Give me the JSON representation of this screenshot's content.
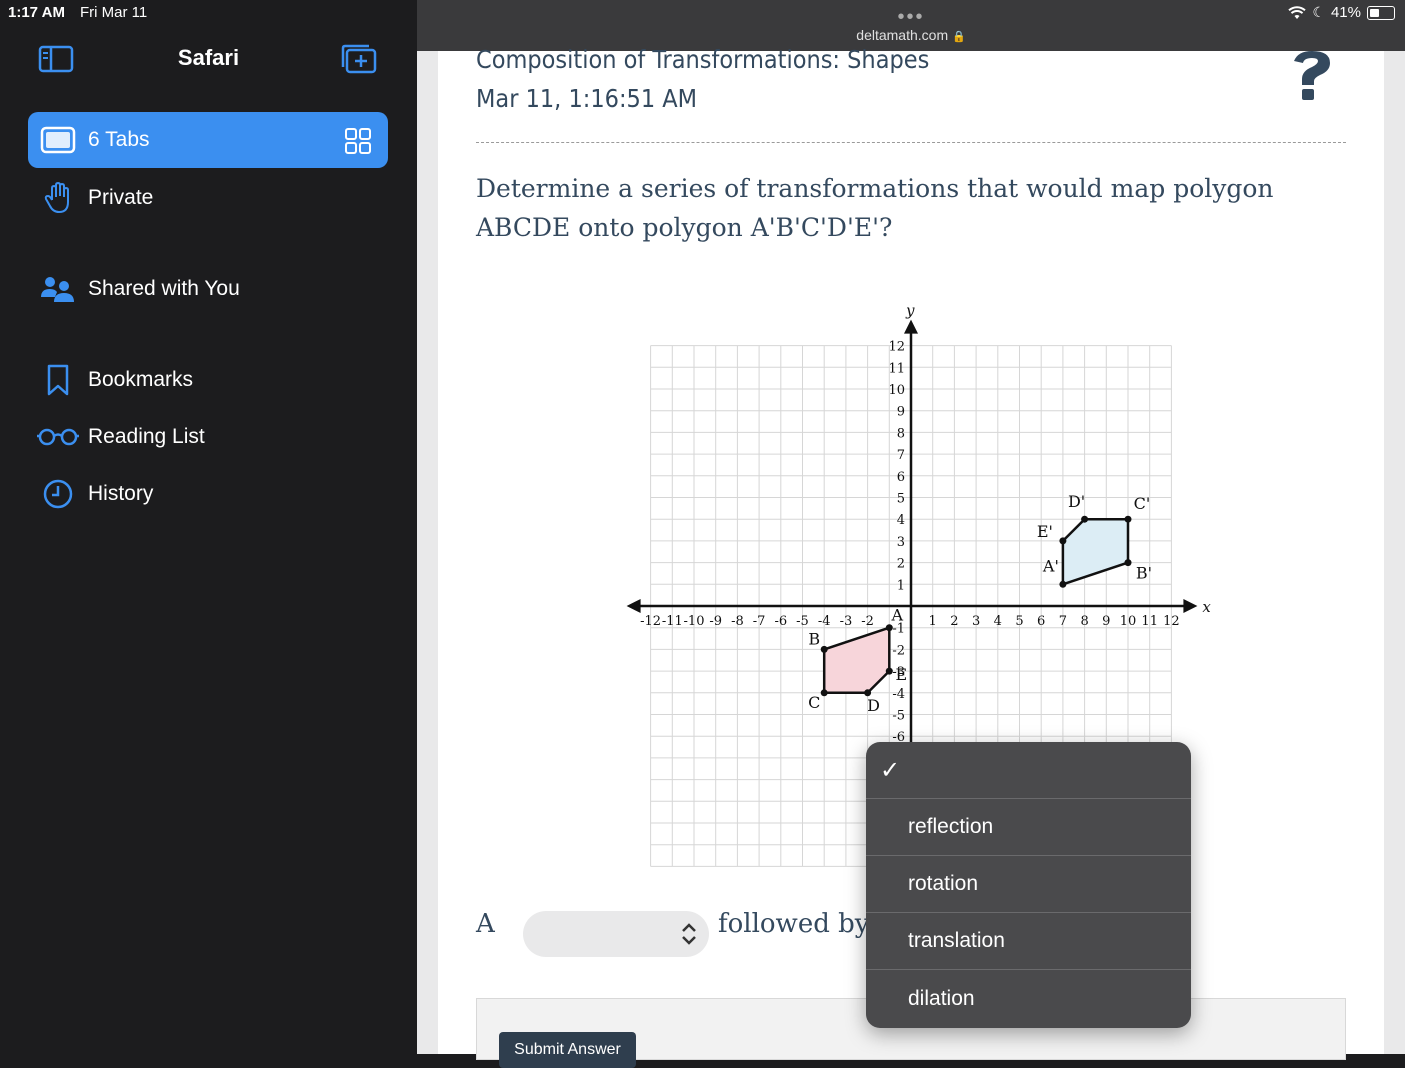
{
  "status": {
    "time": "1:17 AM",
    "date": "Fri Mar 11",
    "battery": "41%"
  },
  "sidebar": {
    "title": "Safari",
    "items": [
      {
        "label": "6 Tabs",
        "icon": "tabs-icon"
      },
      {
        "label": "Private",
        "icon": "hand-icon"
      },
      {
        "label": "Shared with You",
        "icon": "shared-icon"
      },
      {
        "label": "Bookmarks",
        "icon": "bookmark-icon"
      },
      {
        "label": "Reading List",
        "icon": "glasses-icon"
      },
      {
        "label": "History",
        "icon": "clock-icon"
      }
    ]
  },
  "browser": {
    "url": "deltamath.com",
    "dots": "•••"
  },
  "page": {
    "title": "Composition of Transformations: Shapes",
    "timestamp": "Mar 11, 1:16:51 AM",
    "question": "Determine a series of transformations that would map polygon ABCDE onto polygon A'B'C'D'E'?",
    "answer_prefix": "A",
    "answer_middle": "followed by a",
    "submit_label": "Submit Answer"
  },
  "graph": {
    "x_label": "x",
    "y_label": "y",
    "x_range": [
      -12,
      12
    ],
    "y_range": [
      -12,
      12
    ],
    "polygon_ABCDE": [
      {
        "label": "A",
        "x": -1,
        "y": -1
      },
      {
        "label": "B",
        "x": -4,
        "y": -2
      },
      {
        "label": "C",
        "x": -4,
        "y": -4
      },
      {
        "label": "D",
        "x": -2,
        "y": -4
      },
      {
        "label": "E",
        "x": -1,
        "y": -3
      }
    ],
    "polygon_prime": [
      {
        "label": "A'",
        "x": 7,
        "y": 1
      },
      {
        "label": "B'",
        "x": 10,
        "y": 2
      },
      {
        "label": "C'",
        "x": 10,
        "y": 4
      },
      {
        "label": "D'",
        "x": 8,
        "y": 4
      },
      {
        "label": "E'",
        "x": 7,
        "y": 3
      }
    ],
    "colors": {
      "original": "#f7d5da",
      "image": "#dcedf5"
    }
  },
  "dropdown": {
    "check": "✓",
    "options": [
      "reflection",
      "rotation",
      "translation",
      "dilation"
    ]
  }
}
